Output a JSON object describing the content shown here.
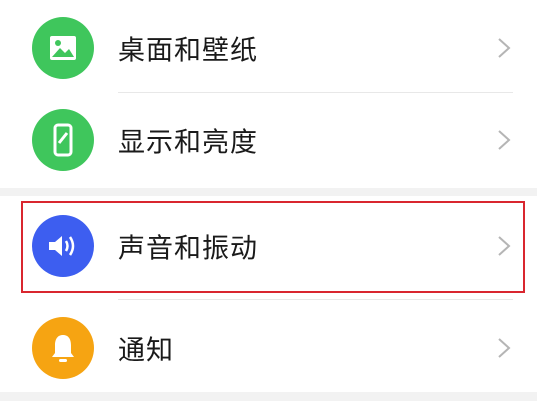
{
  "settings": {
    "items": [
      {
        "label": "桌面和壁纸",
        "icon": "image-icon",
        "color": "#3fc65c"
      },
      {
        "label": "显示和亮度",
        "icon": "phone-brightness-icon",
        "color": "#3fc65c"
      },
      {
        "label": "声音和振动",
        "icon": "speaker-icon",
        "color": "#3d5ef0"
      },
      {
        "label": "通知",
        "icon": "bell-icon",
        "color": "#f6a412"
      }
    ]
  },
  "colors": {
    "highlight_border": "#d9262f",
    "background": "#f2f2f2",
    "text": "#1a1a1a"
  }
}
